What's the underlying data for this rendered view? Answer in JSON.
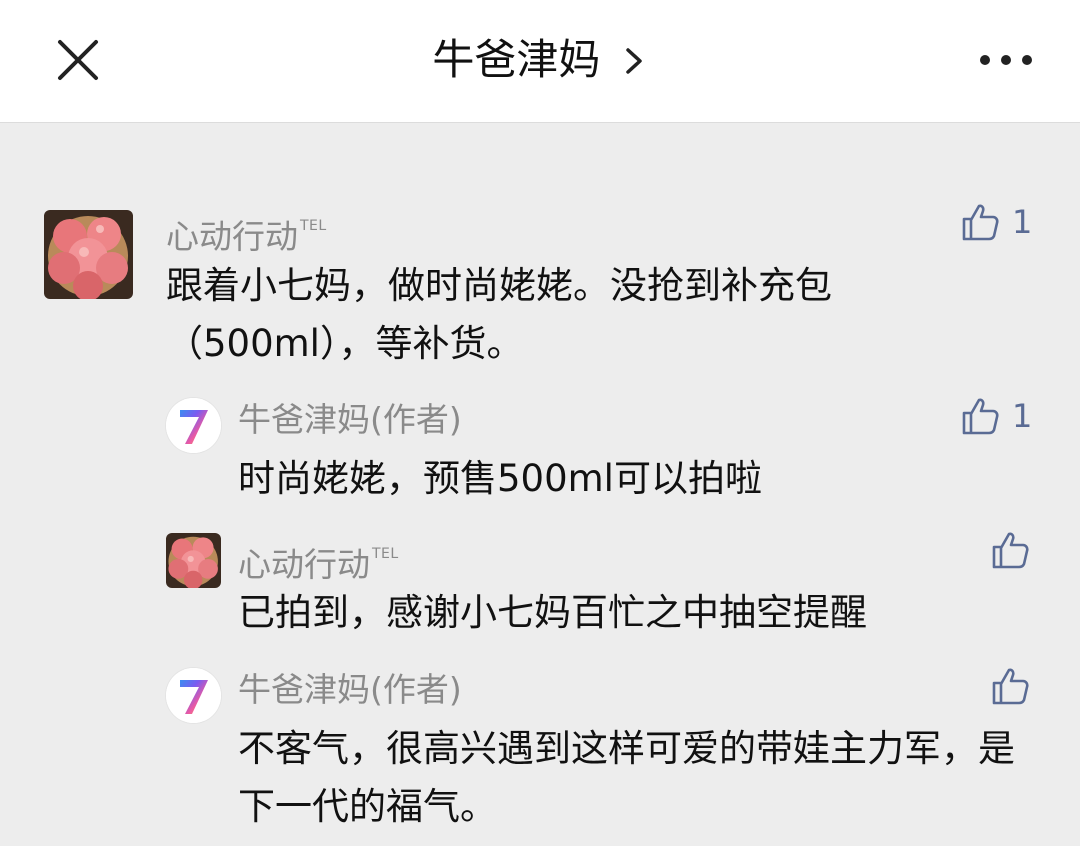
{
  "header": {
    "title": "牛爸津妈",
    "close_icon": "close-icon",
    "chevron_icon": "chevron-right-icon",
    "more_icon": "more-dots-icon"
  },
  "colors": {
    "background": "#ededed",
    "header_background": "#ffffff",
    "name_text": "#8a8a8a",
    "like_accent": "#5a6b94"
  },
  "comments": [
    {
      "name": "心动行动",
      "name_badge": "TEL",
      "avatar": "apple-avatar",
      "text": "跟着小七妈，做时尚姥姥。没抢到补充包（500ml），等补货。",
      "likes": "1"
    },
    {
      "name": "牛爸津妈(作者)",
      "avatar": "seven-avatar",
      "avatar_glyph": "7",
      "text": "时尚姥姥，预售500ml可以拍啦",
      "likes": "1"
    },
    {
      "name": "心动行动",
      "name_badge": "TEL",
      "avatar": "apple-avatar",
      "text": "已拍到，感谢小七妈百忙之中抽空提醒",
      "likes": ""
    },
    {
      "name": "牛爸津妈(作者)",
      "avatar": "seven-avatar",
      "avatar_glyph": "7",
      "text": "不客气，很高兴遇到这样可爱的带娃主力军，是下一代的福气。",
      "likes": ""
    }
  ]
}
